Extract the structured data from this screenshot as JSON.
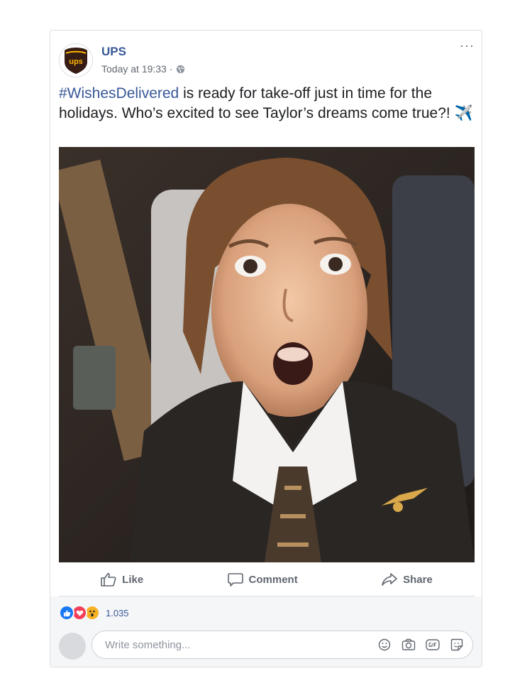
{
  "post": {
    "page_name": "UPS",
    "logo_text": "ups",
    "timestamp": "Today at 19:33",
    "separator": "·",
    "more_label": "···",
    "hashtag": "#WishesDelivered",
    "body": " is ready  for take-off  just in time for the holidays. Who’s excited to see Taylor’s dreams come true?! ",
    "emoji": "✈️"
  },
  "actions": {
    "like": "Like",
    "comment": "Comment",
    "share": "Share"
  },
  "reactions": {
    "count": "1.035",
    "types": [
      "like",
      "love",
      "wow"
    ]
  },
  "comment_box": {
    "placeholder": "Write something..."
  },
  "icons": {
    "comment_tools": [
      "emoji-icon",
      "camera-icon",
      "gif-icon",
      "sticker-icon"
    ]
  },
  "colors": {
    "link_blue": "#385898",
    "ups_brown": "#351c15",
    "ups_gold": "#ffb500",
    "like_blue": "#1877f2",
    "love_red": "#f33e58",
    "wow_yellow": "#f7b125"
  }
}
